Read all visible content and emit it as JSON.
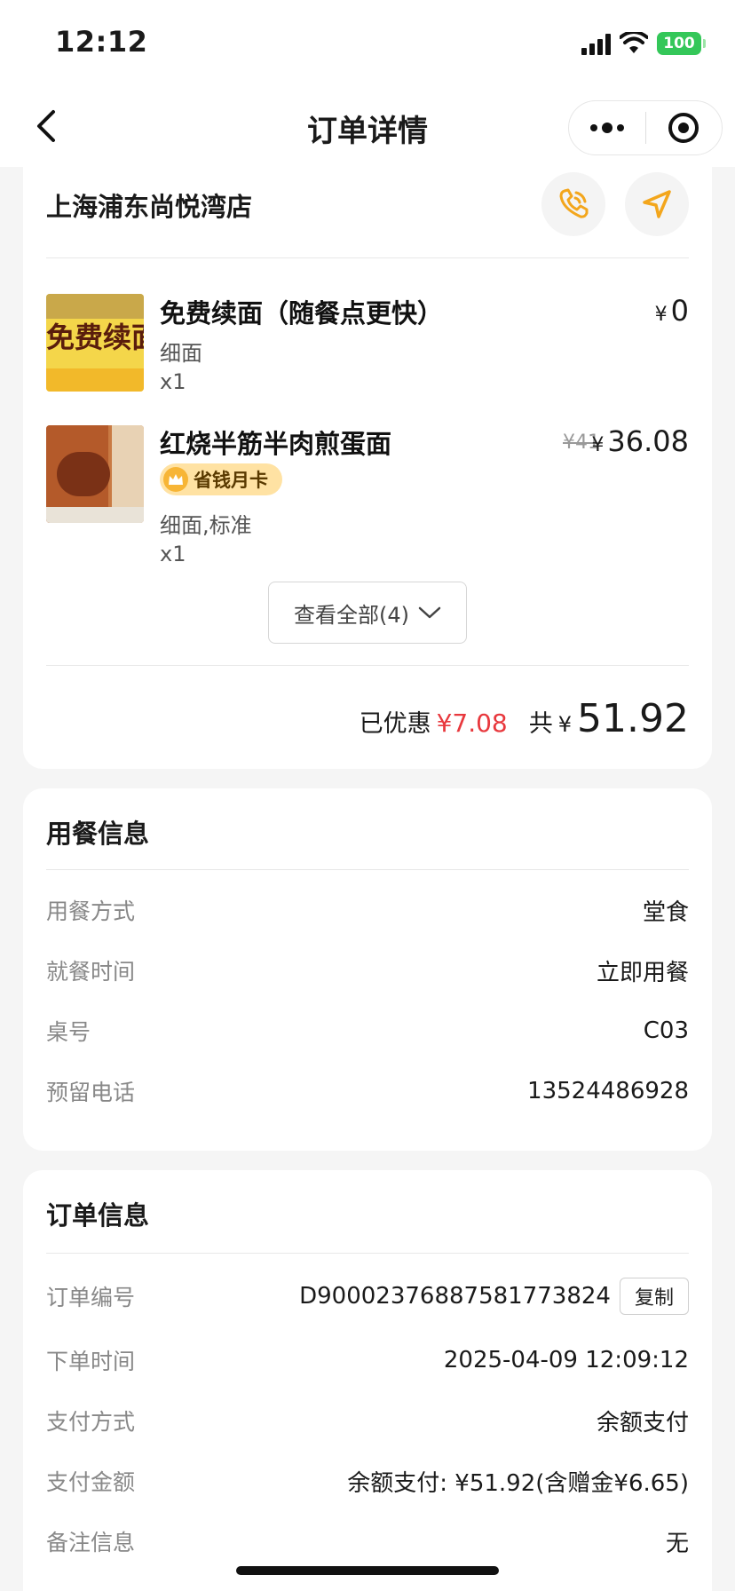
{
  "status": {
    "time": "12:12",
    "battery": "100"
  },
  "nav": {
    "title": "订单详情"
  },
  "store": {
    "name": "上海浦东尚悦湾店"
  },
  "items": [
    {
      "image_text": "免费续面",
      "name": "免费续面（随餐点更快）",
      "spec": "细面",
      "qty": "x1",
      "currency": "¥",
      "price": "0"
    },
    {
      "name": "红烧半筋半肉煎蛋面",
      "badge": "省钱月卡",
      "spec": "细面,标准",
      "qty": "x1",
      "currency": "¥",
      "original_price": "¥41",
      "price": "36.08"
    }
  ],
  "view_all_label": "查看全部(4)",
  "summary": {
    "discount_label": "已优惠",
    "discount_value": "¥7.08",
    "total_label": "共",
    "currency": "¥",
    "total": "51.92"
  },
  "dining": {
    "title": "用餐信息",
    "rows": [
      {
        "key": "用餐方式",
        "value": "堂食"
      },
      {
        "key": "就餐时间",
        "value": "立即用餐"
      },
      {
        "key": "桌号",
        "value": "C03"
      },
      {
        "key": "预留电话",
        "value": "13524486928"
      }
    ]
  },
  "order": {
    "title": "订单信息",
    "copy_label": "复制",
    "rows": [
      {
        "key": "订单编号",
        "value": "D9000237688758177382​4"
      },
      {
        "key": "下单时间",
        "value": "2025-04-09 12:09:12"
      },
      {
        "key": "支付方式",
        "value": "余额支付"
      },
      {
        "key": "支付金额",
        "value": "余额支付: ¥51.92(含赠金¥6.65)"
      },
      {
        "key": "备注信息",
        "value": "无"
      }
    ]
  },
  "colors": {
    "discount": "#e8383d",
    "accent": "#f3a61c",
    "badge_bg": "#ffe2a3"
  }
}
